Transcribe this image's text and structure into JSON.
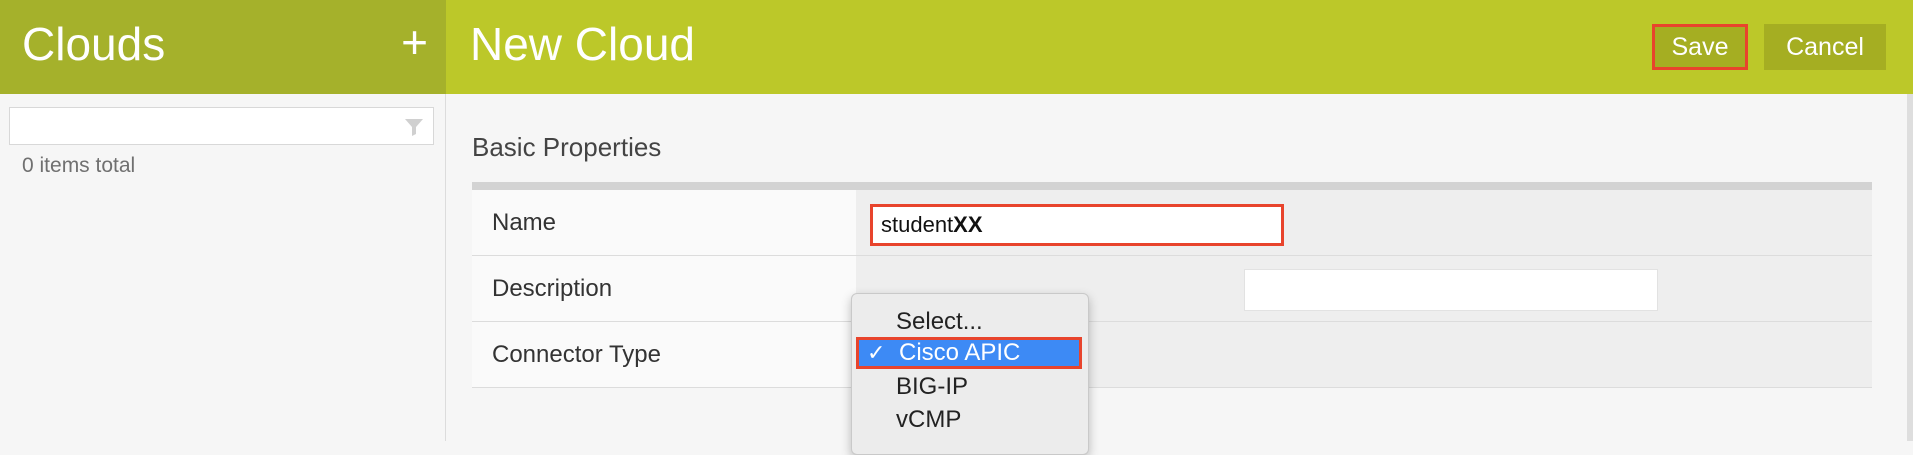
{
  "left": {
    "title": "Clouds",
    "add_label": "+",
    "filter_value": "",
    "items_total": "0 items total"
  },
  "header": {
    "title": "New Cloud",
    "save_label": "Save",
    "cancel_label": "Cancel"
  },
  "section": {
    "title": "Basic Properties"
  },
  "form": {
    "name_label": "Name",
    "name_value_prefix": "student",
    "name_value_suffix": "XX",
    "description_label": "Description",
    "description_value": "",
    "connector_label": "Connector Type"
  },
  "dropdown": {
    "options": [
      "Select...",
      "Cisco APIC",
      "BIG-IP",
      "vCMP"
    ],
    "selected": "Cisco APIC",
    "check_glyph": "✓"
  },
  "colors": {
    "left_header": "#a5b12b",
    "right_header": "#bcc829",
    "highlight": "#e8442c",
    "selection": "#3d8af5"
  }
}
